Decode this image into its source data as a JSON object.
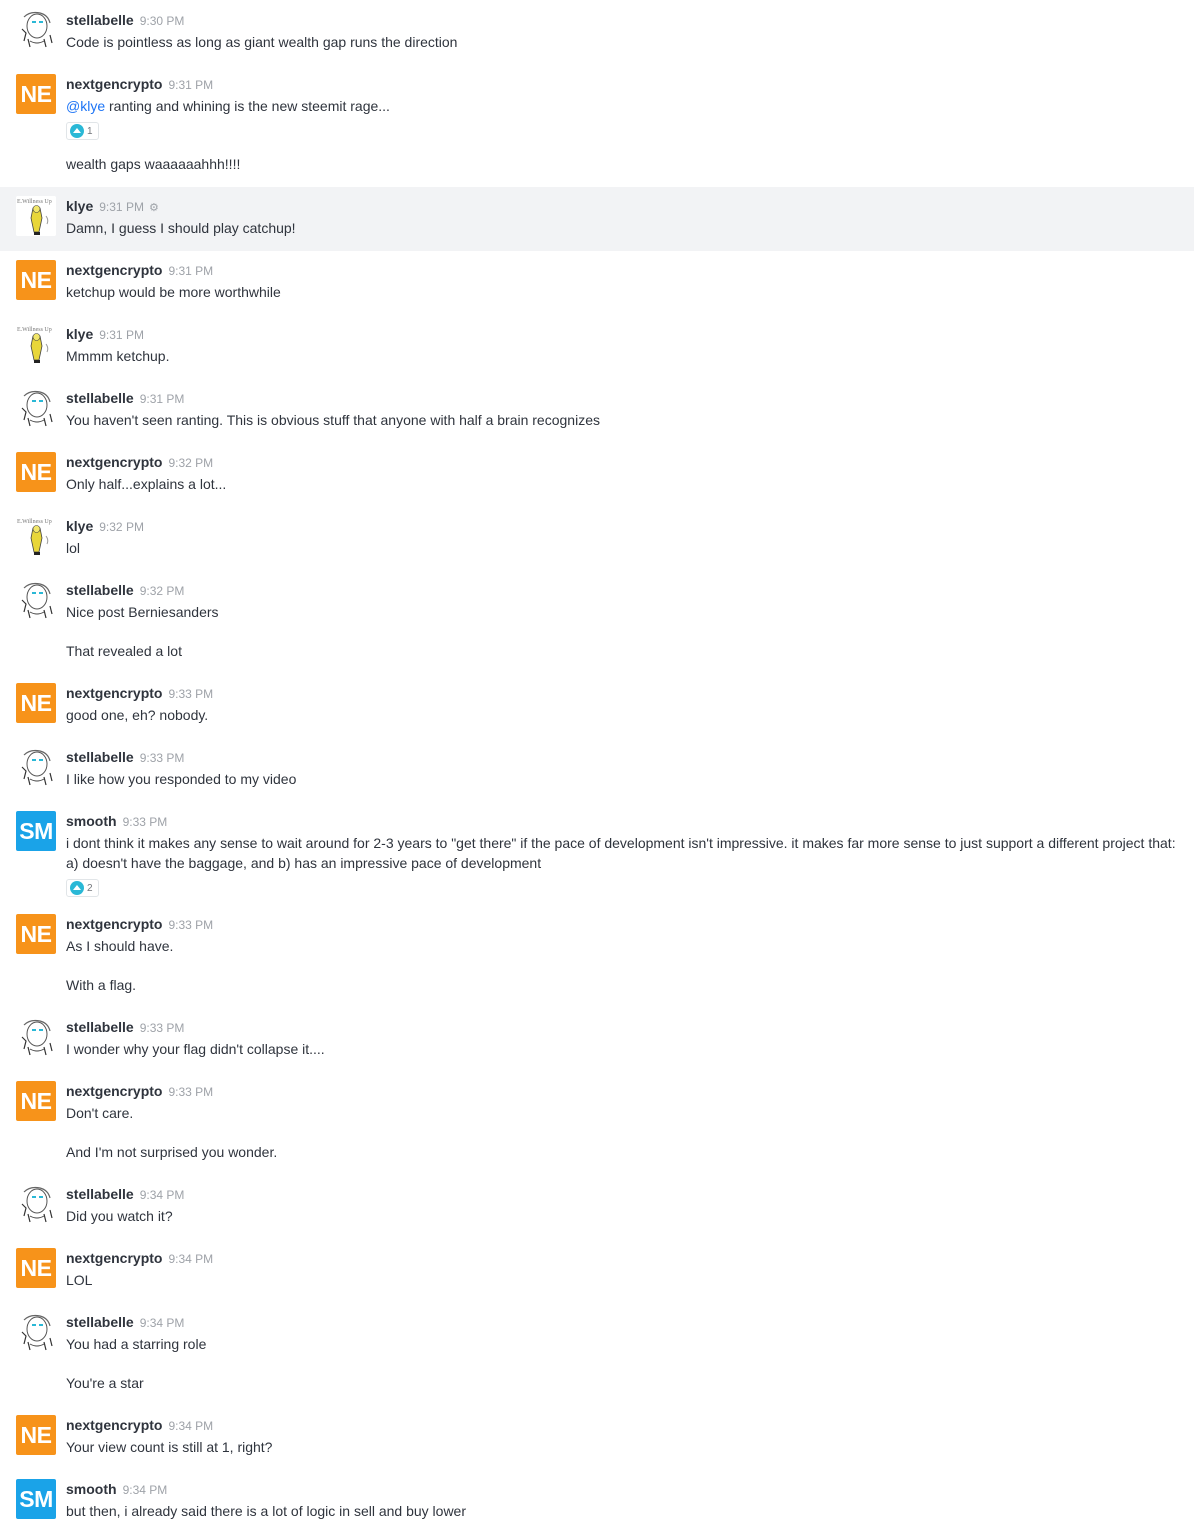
{
  "messages": [
    {
      "user": "stellabelle",
      "avatar": "stella",
      "time": "9:30 PM",
      "lines": [
        "Code is pointless as long as giant wealth gap runs the direction"
      ]
    },
    {
      "user": "nextgencrypto",
      "avatar": "NE",
      "time": "9:31 PM",
      "mention": "@klye",
      "lines": [
        "ranting and whining is the new steemit rage...",
        "wealth gaps waaaaaahhh!!!!"
      ],
      "reaction_count": "1"
    },
    {
      "user": "klye",
      "avatar": "klye",
      "time": "9:31 PM",
      "highlight": true,
      "lines": [
        "Damn, I guess I should play catchup!"
      ]
    },
    {
      "user": "nextgencrypto",
      "avatar": "NE",
      "time": "9:31 PM",
      "lines": [
        "ketchup would be more worthwhile"
      ]
    },
    {
      "user": "klye",
      "avatar": "klye",
      "time": "9:31 PM",
      "lines": [
        "Mmmm ketchup."
      ]
    },
    {
      "user": "stellabelle",
      "avatar": "stella",
      "time": "9:31 PM",
      "lines": [
        "You haven't seen ranting. This is obvious stuff that anyone with half a brain recognizes"
      ]
    },
    {
      "user": "nextgencrypto",
      "avatar": "NE",
      "time": "9:32 PM",
      "lines": [
        "Only half...explains a lot..."
      ]
    },
    {
      "user": "klye",
      "avatar": "klye",
      "time": "9:32 PM",
      "lines": [
        "lol"
      ]
    },
    {
      "user": "stellabelle",
      "avatar": "stella",
      "time": "9:32 PM",
      "lines": [
        "Nice post Berniesanders",
        "That revealed a lot"
      ]
    },
    {
      "user": "nextgencrypto",
      "avatar": "NE",
      "time": "9:33 PM",
      "lines": [
        "good one, eh? nobody."
      ]
    },
    {
      "user": "stellabelle",
      "avatar": "stella",
      "time": "9:33 PM",
      "lines": [
        "I like how you responded to my video"
      ]
    },
    {
      "user": "smooth",
      "avatar": "SM",
      "time": "9:33 PM",
      "lines": [
        "i dont think it makes any sense to wait around for 2-3 years to \"get there\" if the pace of development isn't impressive. it makes far more sense to just support a different project that: a) doesn't have the baggage, and b) has an impressive pace of development"
      ],
      "reaction_count": "2"
    },
    {
      "user": "nextgencrypto",
      "avatar": "NE",
      "time": "9:33 PM",
      "lines": [
        "As I should have.",
        "With a flag."
      ]
    },
    {
      "user": "stellabelle",
      "avatar": "stella",
      "time": "9:33 PM",
      "lines": [
        "I wonder why your flag didn't collapse it...."
      ]
    },
    {
      "user": "nextgencrypto",
      "avatar": "NE",
      "time": "9:33 PM",
      "lines": [
        "Don't care.",
        "And I'm not surprised you wonder."
      ]
    },
    {
      "user": "stellabelle",
      "avatar": "stella",
      "time": "9:34 PM",
      "lines": [
        "Did you watch it?"
      ]
    },
    {
      "user": "nextgencrypto",
      "avatar": "NE",
      "time": "9:34 PM",
      "lines": [
        "LOL"
      ]
    },
    {
      "user": "stellabelle",
      "avatar": "stella",
      "time": "9:34 PM",
      "lines": [
        "You had a starring role",
        "You're a star"
      ]
    },
    {
      "user": "nextgencrypto",
      "avatar": "NE",
      "time": "9:34 PM",
      "lines": [
        "Your view count is still at 1, right?"
      ]
    },
    {
      "user": "smooth",
      "avatar": "SM",
      "time": "9:34 PM",
      "lines": [
        "but then, i already said there is a lot of logic in sell and buy lower"
      ]
    }
  ],
  "colors": {
    "ne_avatar": "#f7931a",
    "sm_avatar": "#1aa3e8",
    "mention": "#1d74f5",
    "reaction": "#2ab8d6",
    "highlight_bg": "#f2f3f5"
  },
  "icons": {
    "stella": "stellabelle-avatar",
    "klye": "klye-avatar",
    "settings": "gear-icon",
    "reaction": "upvote-reaction-icon"
  }
}
